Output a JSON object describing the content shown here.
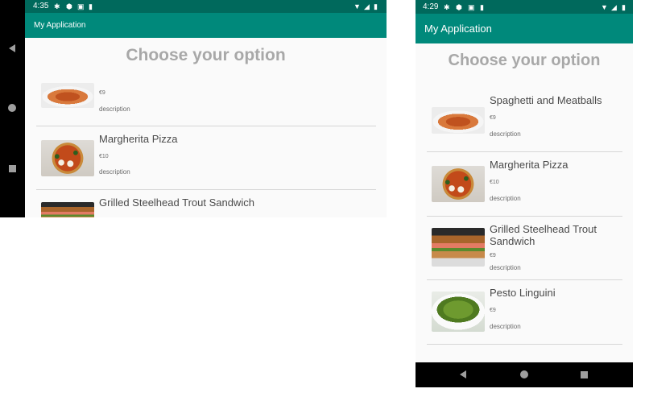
{
  "left": {
    "status": {
      "time": "4:35"
    },
    "app_title": "My Application",
    "heading": "Choose your option",
    "items": [
      {
        "name": "",
        "price": "€9",
        "description": "description"
      },
      {
        "name": "Margherita Pizza",
        "price": "€10",
        "description": "description"
      },
      {
        "name": "Grilled Steelhead Trout Sandwich"
      }
    ]
  },
  "right": {
    "status": {
      "time": "4:29"
    },
    "app_title": "My Application",
    "heading": "Choose your option",
    "items": [
      {
        "name": "Spaghetti and Meatballs",
        "price": "€9",
        "description": "description"
      },
      {
        "name": "Margherita Pizza",
        "price": "€10",
        "description": "description"
      },
      {
        "name": "Grilled Steelhead Trout Sandwich",
        "price": "€9",
        "description": "description"
      },
      {
        "name": "Pesto Linguini",
        "price": "€9",
        "description": "description"
      }
    ]
  },
  "icons": {
    "status": [
      "settings-icon",
      "shield-icon",
      "a-icon",
      "sd-card-icon",
      "wifi-icon",
      "signal-icon",
      "battery-icon"
    ],
    "nav": [
      "back-icon",
      "home-icon",
      "recents-icon"
    ]
  },
  "colors": {
    "status_bar": "#00695c",
    "app_bar": "#00897b",
    "heading": "#a8a8a8"
  }
}
